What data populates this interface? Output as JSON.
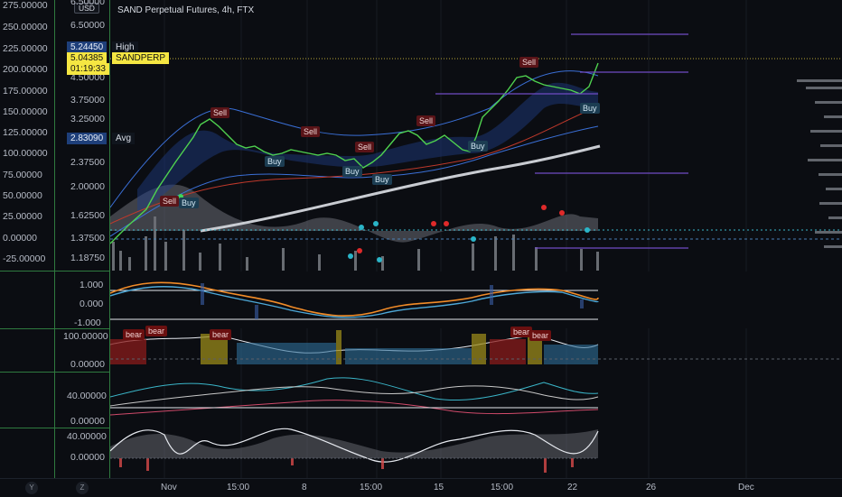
{
  "header": {
    "title": "SAND Perpetual Futures, 4h, FTX",
    "currency_button": "USD",
    "top_price_partial": "6.50000"
  },
  "left_axis": {
    "ticks": [
      "275.00000",
      "250.00000",
      "225.00000",
      "200.00000",
      "175.00000",
      "150.00000",
      "125.00000",
      "100.00000",
      "75.00000",
      "50.00000",
      "25.00000",
      "0.00000",
      "-25.00000"
    ]
  },
  "price_axis": {
    "ticks": [
      "6.50000",
      "4.50000",
      "3.75000",
      "3.25000",
      "2.37500",
      "2.00000",
      "1.62500",
      "1.37500",
      "1.18750"
    ],
    "high_value": "5.24450",
    "high_label": "High",
    "current_value": "5.04385",
    "current_symbol": "SANDPERP",
    "countdown": "01:19:33",
    "avg_value": "2.83090",
    "avg_label": "Avg"
  },
  "signals": {
    "sell": "Sell",
    "buy": "Buy",
    "bear": "bear"
  },
  "pane2": {
    "ticks": [
      "1.000",
      "0.000",
      "-1.000"
    ]
  },
  "pane3": {
    "ticks": [
      "100.00000",
      "0.00000"
    ]
  },
  "pane4": {
    "ticks": [
      "40.00000",
      "0.00000"
    ]
  },
  "pane5": {
    "ticks": [
      "40.00000",
      "0.00000"
    ]
  },
  "x_axis": {
    "ticks": [
      "Nov",
      "15:00",
      "8",
      "15:00",
      "15",
      "15:00",
      "22",
      "26",
      "Dec"
    ]
  },
  "corner_buttons": [
    "Y",
    "Z"
  ],
  "colors": {
    "sell": "#5a1418",
    "buy": "#1c3d52",
    "current": "#f5e642",
    "separator": "#2f7a3f"
  }
}
